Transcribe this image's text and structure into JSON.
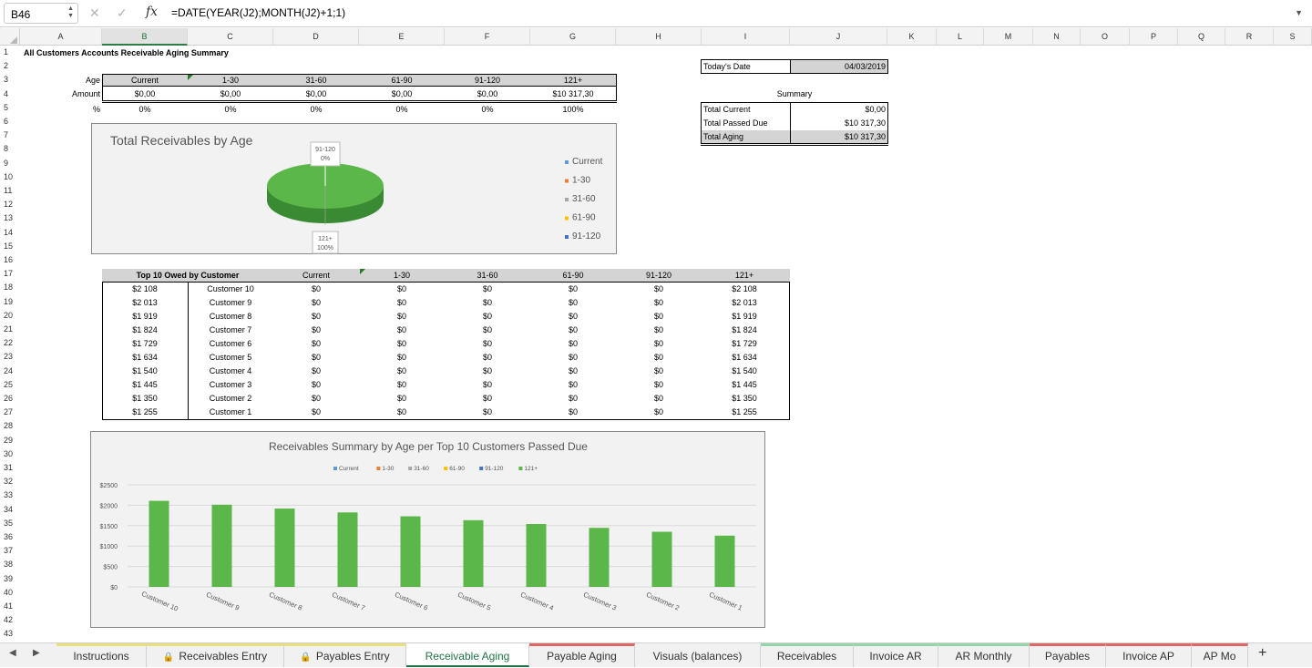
{
  "formula_bar": {
    "name_box": "B46",
    "cancel_icon": "✕",
    "enter_icon": "✓",
    "fx": "fx",
    "formula": "=DATE(YEAR(J2);MONTH(J2)+1;1)"
  },
  "columns": [
    "A",
    "B",
    "C",
    "D",
    "E",
    "F",
    "G",
    "H",
    "I",
    "J",
    "K",
    "L",
    "M",
    "N",
    "O",
    "P",
    "Q",
    "R",
    "S"
  ],
  "selected_column": "B",
  "rows": [
    "1",
    "2",
    "3",
    "4",
    "5",
    "6",
    "7",
    "8",
    "9",
    "10",
    "11",
    "12",
    "13",
    "14",
    "15",
    "16",
    "17",
    "18",
    "19",
    "20",
    "21",
    "22",
    "23",
    "24",
    "25",
    "26",
    "27",
    "28",
    "29",
    "30",
    "31",
    "32",
    "33",
    "34",
    "35",
    "36",
    "37",
    "38",
    "39",
    "40",
    "41",
    "42",
    "43"
  ],
  "sheet": {
    "title": "All Customers Accounts Receivable Aging Summary",
    "age_label": "Age",
    "amount_label": "Amount",
    "pct_label": "%",
    "age_buckets": [
      "Current",
      "1-30",
      "31-60",
      "61-90",
      "91-120",
      "121+"
    ],
    "amounts": [
      "$0,00",
      "$0,00",
      "$0,00",
      "$0,00",
      "$0,00",
      "$10 317,30"
    ],
    "percents": [
      "0%",
      "0%",
      "0%",
      "0%",
      "0%",
      "100%"
    ],
    "todays_date_label": "Today's Date",
    "todays_date": "04/03/2019",
    "summary_label": "Summary",
    "summary": [
      {
        "label": "Total Current",
        "value": "$0,00"
      },
      {
        "label": "Total Passed Due",
        "value": "$10 317,30"
      },
      {
        "label": "Total Aging",
        "value": "$10 317,30"
      }
    ],
    "top10_header": "Top 10 Owed by Customer",
    "top10_columns": [
      "Current",
      "1-30",
      "31-60",
      "61-90",
      "91-120",
      "121+"
    ],
    "top10": [
      {
        "total": "$2 108",
        "customer": "Customer 10",
        "current": "$0",
        "b1": "$0",
        "b2": "$0",
        "b3": "$0",
        "b4": "$0",
        "b5": "$2 108"
      },
      {
        "total": "$2 013",
        "customer": "Customer 9",
        "current": "$0",
        "b1": "$0",
        "b2": "$0",
        "b3": "$0",
        "b4": "$0",
        "b5": "$2 013"
      },
      {
        "total": "$1 919",
        "customer": "Customer 8",
        "current": "$0",
        "b1": "$0",
        "b2": "$0",
        "b3": "$0",
        "b4": "$0",
        "b5": "$1 919"
      },
      {
        "total": "$1 824",
        "customer": "Customer 7",
        "current": "$0",
        "b1": "$0",
        "b2": "$0",
        "b3": "$0",
        "b4": "$0",
        "b5": "$1 824"
      },
      {
        "total": "$1 729",
        "customer": "Customer 6",
        "current": "$0",
        "b1": "$0",
        "b2": "$0",
        "b3": "$0",
        "b4": "$0",
        "b5": "$1 729"
      },
      {
        "total": "$1 634",
        "customer": "Customer 5",
        "current": "$0",
        "b1": "$0",
        "b2": "$0",
        "b3": "$0",
        "b4": "$0",
        "b5": "$1 634"
      },
      {
        "total": "$1 540",
        "customer": "Customer 4",
        "current": "$0",
        "b1": "$0",
        "b2": "$0",
        "b3": "$0",
        "b4": "$0",
        "b5": "$1 540"
      },
      {
        "total": "$1 445",
        "customer": "Customer 3",
        "current": "$0",
        "b1": "$0",
        "b2": "$0",
        "b3": "$0",
        "b4": "$0",
        "b5": "$1 445"
      },
      {
        "total": "$1 350",
        "customer": "Customer 2",
        "current": "$0",
        "b1": "$0",
        "b2": "$0",
        "b3": "$0",
        "b4": "$0",
        "b5": "$1 350"
      },
      {
        "total": "$1 255",
        "customer": "Customer 1",
        "current": "$0",
        "b1": "$0",
        "b2": "$0",
        "b3": "$0",
        "b4": "$0",
        "b5": "$1 255"
      }
    ]
  },
  "chart_data": [
    {
      "type": "pie",
      "title": "Total Receivables by Age",
      "labels": [
        "Current",
        "1-30",
        "31-60",
        "61-90",
        "91-120",
        "121+"
      ],
      "values": [
        0,
        0,
        0,
        0,
        0,
        100
      ],
      "legend": [
        "Current",
        "1-30",
        "31-60",
        "61-90",
        "91-120"
      ],
      "legend_position": "right",
      "data_labels": [
        {
          "category": "91-120",
          "value": "0%"
        },
        {
          "category": "121+",
          "value": "100%"
        }
      ],
      "colors": [
        "#5b9bd5",
        "#ed7d31",
        "#a5a5a5",
        "#ffc000",
        "#4472c4",
        "#5bb749"
      ]
    },
    {
      "type": "bar",
      "title": "Receivables Summary by Age per Top 10 Customers Passed Due",
      "categories": [
        "Customer 10",
        "Customer 9",
        "Customer 8",
        "Customer 7",
        "Customer 6",
        "Customer 5",
        "Customer 4",
        "Customer 3",
        "Customer 2",
        "Customer 1"
      ],
      "series": [
        {
          "name": "Current",
          "values": [
            0,
            0,
            0,
            0,
            0,
            0,
            0,
            0,
            0,
            0
          ],
          "color": "#5b9bd5"
        },
        {
          "name": "1-30",
          "values": [
            0,
            0,
            0,
            0,
            0,
            0,
            0,
            0,
            0,
            0
          ],
          "color": "#ed7d31"
        },
        {
          "name": "31-60",
          "values": [
            0,
            0,
            0,
            0,
            0,
            0,
            0,
            0,
            0,
            0
          ],
          "color": "#a5a5a5"
        },
        {
          "name": "61-90",
          "values": [
            0,
            0,
            0,
            0,
            0,
            0,
            0,
            0,
            0,
            0
          ],
          "color": "#ffc000"
        },
        {
          "name": "91-120",
          "values": [
            0,
            0,
            0,
            0,
            0,
            0,
            0,
            0,
            0,
            0
          ],
          "color": "#4472c4"
        },
        {
          "name": "121+",
          "values": [
            2108,
            2013,
            1919,
            1824,
            1729,
            1634,
            1540,
            1445,
            1350,
            1255
          ],
          "color": "#5bb749"
        }
      ],
      "y_ticks": [
        "$0",
        "$500",
        "$1000",
        "$1500",
        "$2000",
        "$2500"
      ],
      "ylim": [
        0,
        2500
      ],
      "grid": true,
      "legend_position": "top"
    }
  ],
  "tabs": [
    {
      "label": "Instructions",
      "locked": false,
      "active": false,
      "color": "#e8e07a"
    },
    {
      "label": "Receivables Entry",
      "locked": true,
      "active": false,
      "color": "#e8e07a"
    },
    {
      "label": "Payables Entry",
      "locked": true,
      "active": false,
      "color": "#e8e07a"
    },
    {
      "label": "Receivable Aging",
      "locked": false,
      "active": true,
      "color": "#217346"
    },
    {
      "label": "Payable Aging",
      "locked": false,
      "active": false,
      "color": "#e06666"
    },
    {
      "label": "Visuals (balances)",
      "locked": false,
      "active": false,
      "color": "#f1f1f1"
    },
    {
      "label": "Receivables",
      "locked": false,
      "active": false,
      "color": "#93d4a8"
    },
    {
      "label": "Invoice AR",
      "locked": false,
      "active": false,
      "color": "#93d4a8"
    },
    {
      "label": "AR Monthly",
      "locked": false,
      "active": false,
      "color": "#93d4a8"
    },
    {
      "label": "Payables",
      "locked": false,
      "active": false,
      "color": "#e06666"
    },
    {
      "label": "Invoice AP",
      "locked": false,
      "active": false,
      "color": "#e06666"
    },
    {
      "label": "AP Mo",
      "locked": false,
      "active": false,
      "color": "#e06666"
    }
  ],
  "add_sheet": "+"
}
